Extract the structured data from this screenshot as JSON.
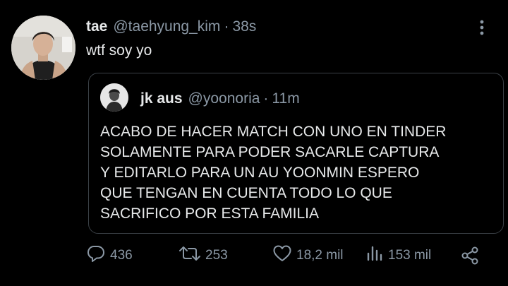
{
  "tweet": {
    "author_name": "tae",
    "author_handle": "@taehyung_kim",
    "separator": "·",
    "time": "38s",
    "text": "wtf soy yo"
  },
  "quote": {
    "author_name": "jk aus",
    "author_handle": "@yoonoria",
    "separator": "·",
    "time": "11m",
    "lines": [
      "ACABO DE HACER MATCH CON UNO EN TINDER",
      "SOLAMENTE PARA PODER SACARLE CAPTURA",
      "Y EDITARLO PARA UN AU YOONMIN ESPERO",
      "QUE TENGAN EN CUENTA TODO LO QUE",
      "SACRIFICO POR ESTA FAMILIA"
    ]
  },
  "actions": {
    "replies": "436",
    "retweets": "253",
    "likes": "18,2 mil",
    "views": "153 mil"
  },
  "icons": {
    "reply": "reply-icon",
    "retweet": "retweet-icon",
    "like": "heart-icon",
    "views": "views-icon",
    "share": "share-icon",
    "more": "more-options-icon"
  },
  "colors": {
    "background": "#000000",
    "text_primary": "#e7e9ea",
    "text_secondary": "#8b98a5",
    "border": "#3b4147"
  }
}
